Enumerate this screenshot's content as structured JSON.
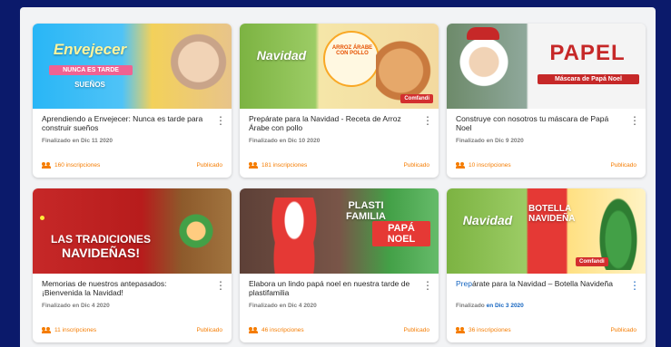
{
  "cards": [
    {
      "title": "Aprendiendo a Envejecer: Nunca es tarde para construir sueños",
      "date": "Finalizado en Dic 11 2020",
      "enrollments": "160 inscripciones",
      "status": "Publicado",
      "banner_text_1": "Envejecer",
      "banner_text_2": "NUNCA ES TARDE",
      "banner_text_3": "SUEÑOS",
      "banner_colors": [
        "#29b6f6",
        "#f3d15a"
      ]
    },
    {
      "title": "Prepárate para la Navidad - Receta de Arroz Árabe con pollo",
      "date": "Finalizado en Dic 10 2020",
      "enrollments": "181 inscripciones",
      "status": "Publicado",
      "banner_text_1": "Navidad",
      "banner_text_2": "ARROZ ÁRABE CON POLLO",
      "banner_text_3": "Comfandi",
      "banner_colors": [
        "#7cb342",
        "#f5e6a8"
      ]
    },
    {
      "title": "Construye con nosotros tu máscara de Papá Noel",
      "date": "Finalizado en Dic 9 2020",
      "enrollments": "10 inscripciones",
      "status": "Publicado",
      "banner_text_1": "PAPEL",
      "banner_text_2": "Máscara de Papá Noel",
      "banner_text_3": "",
      "banner_colors": [
        "#c62828",
        "#f4f4f4"
      ]
    },
    {
      "title": "Memorias de nuestros antepasados: ¡Bienvenida la Navidad!",
      "date": "Finalizado en Dic 4 2020",
      "enrollments": "11 inscripciones",
      "status": "Publicado",
      "banner_text_1": "LAS TRADICIONES",
      "banner_text_2": "NAVIDEÑAS!",
      "banner_text_3": "",
      "banner_colors": [
        "#c62828",
        "#8d5a2b"
      ]
    },
    {
      "title": "Elabora un lindo papá noel en nuestra tarde de plastifamilia",
      "date": "Finalizado en Dic 4 2020",
      "enrollments": "46 inscripciones",
      "status": "Publicado",
      "banner_text_1": "PLASTI FAMILIA",
      "banner_text_2": "PAPÁ NOEL",
      "banner_text_3": "",
      "banner_colors": [
        "#6d4c41",
        "#43a047"
      ]
    },
    {
      "title_pre": "Prep",
      "title_post": "árate para la Navidad – Botella Navideña",
      "date_pre": "Finalizado ",
      "date_post": "en Dic 3 2020",
      "enrollments": "36 inscripciones",
      "status": "Publicado",
      "banner_text_1": "Navidad",
      "banner_text_2": "BOTELLA NAVIDEÑA",
      "banner_text_3": "Comfandi",
      "banner_colors": [
        "#7cb342",
        "#e53935"
      ]
    }
  ],
  "menu_glyph": "⋮"
}
